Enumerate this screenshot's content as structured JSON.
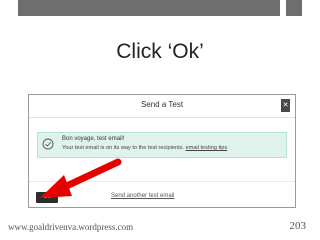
{
  "slide": {
    "title": "Click ‘Ok’",
    "footer_url": "www.goaldrivenva.wordpress.com",
    "page_number": "203"
  },
  "dialog": {
    "title": "Send a Test",
    "close_icon": "close-icon",
    "alert": {
      "icon": "check-circle-icon",
      "title": "Bon voyage, test email!",
      "message": "Your test email is on its way to the test recipients.",
      "link": "email testing tips"
    },
    "ok_label": "Ok",
    "other_link": "Send another test email"
  },
  "colors": {
    "arrow": "#e60000",
    "alert_bg": "#dff3ec",
    "button_bg": "#2d2d2d"
  }
}
